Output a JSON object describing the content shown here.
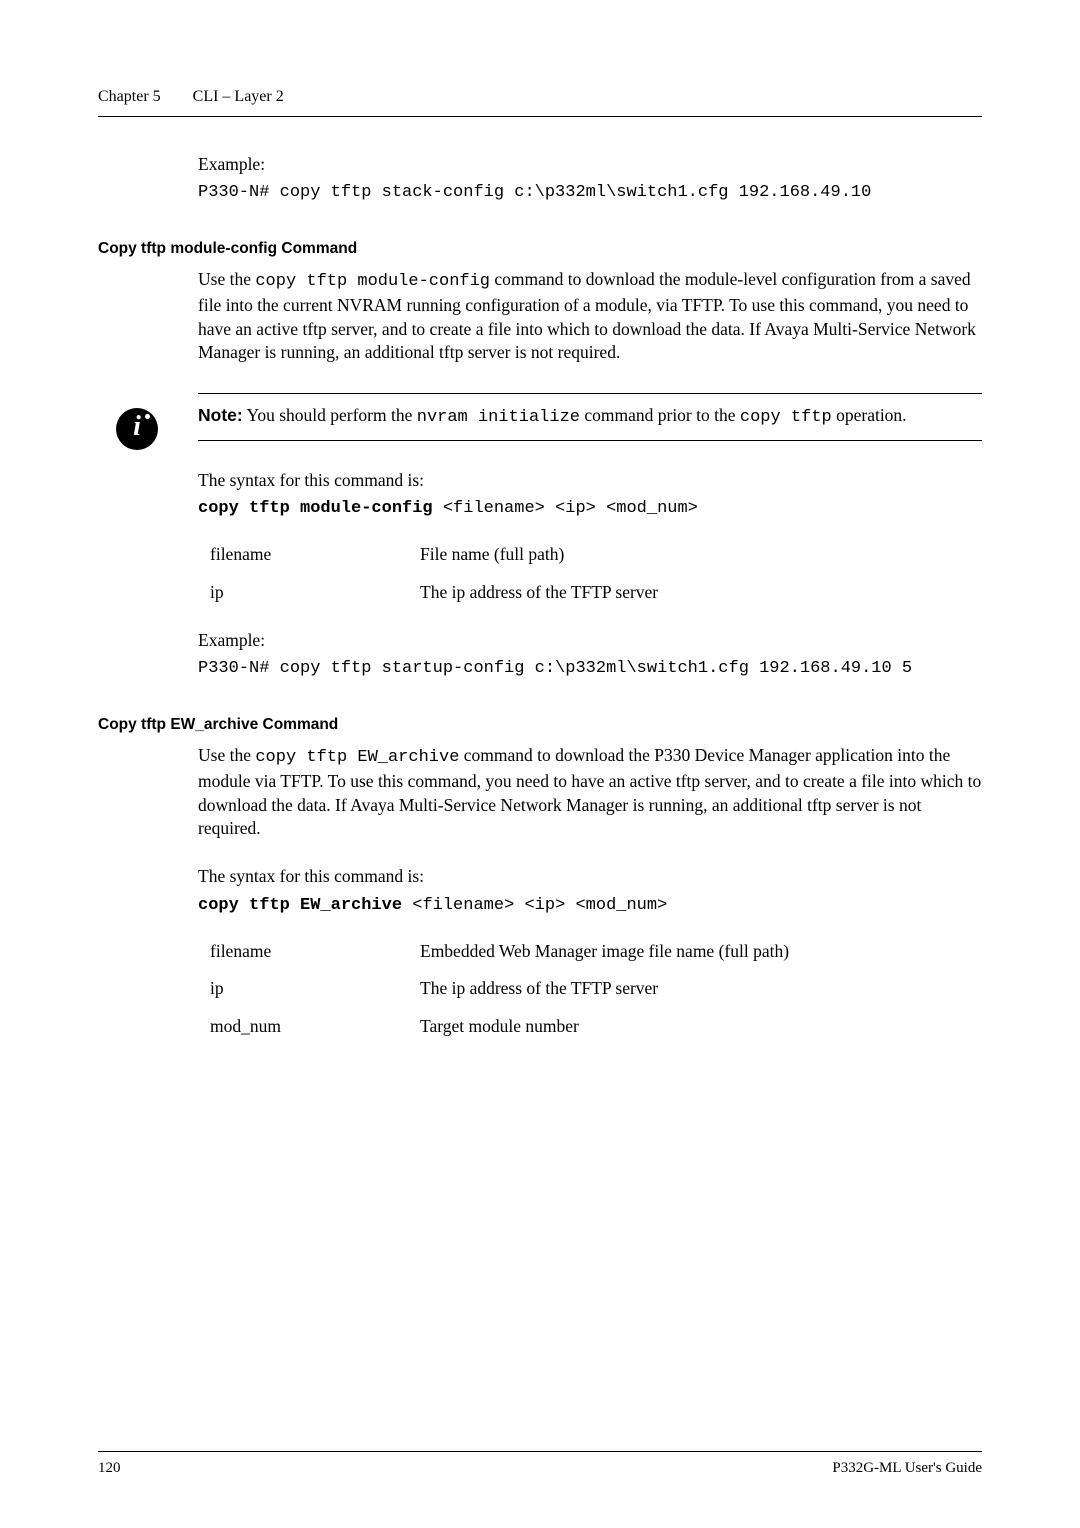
{
  "header": {
    "chapter": "Chapter 5",
    "title": "CLI – Layer 2"
  },
  "intro": {
    "example_label": "Example:",
    "example_code": "P330-N# copy tftp stack-config c:\\p332ml\\switch1.cfg 192.168.49.10"
  },
  "sec1": {
    "title": "Copy tftp module-config Command",
    "p1a": "Use the ",
    "p1code": "copy tftp module-config",
    "p1b": " command to download the module-level configuration from a saved file into the current NVRAM running configuration of a module, via TFTP. To use this command, you need to have an active tftp server, and to create a file into which to download the data. If Avaya Multi-Service Network Manager is running, an additional tftp server is not required.",
    "note_label": "Note:",
    "note_a": "  You should perform the ",
    "note_code1": "nvram initialize",
    "note_b": " command prior to the ",
    "note_code2": "copy tftp",
    "note_c": " operation.",
    "syntax_label": "The syntax for this command is:",
    "syntax_cmd": "copy tftp module-config",
    "syntax_args": " <filename> <ip> <mod_num>",
    "defs": [
      {
        "term": "filename",
        "desc": "File name (full path)"
      },
      {
        "term": "ip",
        "desc": "The ip address of the TFTP server"
      }
    ],
    "example_label": "Example:",
    "example_code": "P330-N# copy tftp startup-config  c:\\p332ml\\switch1.cfg 192.168.49.10 5"
  },
  "sec2": {
    "title": "Copy tftp EW_archive Command",
    "p1a": "Use the ",
    "p1code": "copy tftp EW_archive",
    "p1b": " command to download the P330 Device Manager application into the module via TFTP. To use this command, you need to have an active tftp server, and to create a file into which to download the data. If Avaya Multi-Service Network Manager is running, an additional tftp server is not required.",
    "syntax_label": "The syntax for this command is:",
    "syntax_cmd": "copy tftp EW_archive",
    "syntax_args": " <filename> <ip> <mod_num>",
    "defs": [
      {
        "term": "filename",
        "desc": "Embedded Web Manager image file name (full path)"
      },
      {
        "term": "ip",
        "desc": "The ip address of the TFTP server"
      },
      {
        "term": "mod_num",
        "desc": "Target module number"
      }
    ]
  },
  "footer": {
    "page": "120",
    "guide": "P332G-ML User's Guide"
  }
}
